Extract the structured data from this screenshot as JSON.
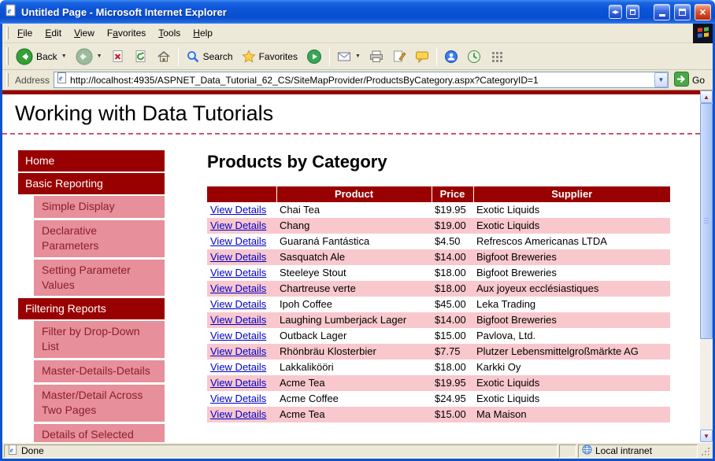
{
  "window": {
    "title": "Untitled Page - Microsoft Internet Explorer",
    "status": {
      "left": "Done",
      "zone": "Local intranet"
    }
  },
  "menu": {
    "items": [
      {
        "label": "File",
        "accel": 0
      },
      {
        "label": "Edit",
        "accel": 0
      },
      {
        "label": "View",
        "accel": 0
      },
      {
        "label": "Favorites",
        "accel": 1
      },
      {
        "label": "Tools",
        "accel": 0
      },
      {
        "label": "Help",
        "accel": 0
      }
    ]
  },
  "toolbar": {
    "back_label": "Back",
    "search_label": "Search",
    "favorites_label": "Favorites"
  },
  "address": {
    "label": "Address",
    "url": "http://localhost:4935/ASPNET_Data_Tutorial_62_CS/SiteMapProvider/ProductsByCategory.aspx?CategoryID=1",
    "go_label": "Go"
  },
  "page": {
    "site_title": "Working with Data Tutorials",
    "heading": "Products by Category",
    "nav": [
      {
        "label": "Home",
        "level": 1
      },
      {
        "label": "Basic Reporting",
        "level": 1
      },
      {
        "label": "Simple Display",
        "level": 2
      },
      {
        "label": "Declarative Parameters",
        "level": 2
      },
      {
        "label": "Setting Parameter Values",
        "level": 2
      },
      {
        "label": "Filtering Reports",
        "level": 1
      },
      {
        "label": "Filter by Drop-Down List",
        "level": 2
      },
      {
        "label": "Master-Details-Details",
        "level": 2
      },
      {
        "label": "Master/Detail Across Two Pages",
        "level": 2
      },
      {
        "label": "Details of Selected Row",
        "level": 2
      }
    ],
    "table": {
      "columns": [
        "",
        "Product",
        "Price",
        "Supplier"
      ],
      "link_label": "View Details",
      "rows": [
        {
          "product": "Chai Tea",
          "price": "$19.95",
          "supplier": "Exotic Liquids"
        },
        {
          "product": "Chang",
          "price": "$19.00",
          "supplier": "Exotic Liquids"
        },
        {
          "product": "Guaraná Fantástica",
          "price": "$4.50",
          "supplier": "Refrescos Americanas LTDA"
        },
        {
          "product": "Sasquatch Ale",
          "price": "$14.00",
          "supplier": "Bigfoot Breweries"
        },
        {
          "product": "Steeleye Stout",
          "price": "$18.00",
          "supplier": "Bigfoot Breweries"
        },
        {
          "product": "Chartreuse verte",
          "price": "$18.00",
          "supplier": "Aux joyeux ecclésiastiques"
        },
        {
          "product": "Ipoh Coffee",
          "price": "$45.00",
          "supplier": "Leka Trading"
        },
        {
          "product": "Laughing Lumberjack Lager",
          "price": "$14.00",
          "supplier": "Bigfoot Breweries"
        },
        {
          "product": "Outback Lager",
          "price": "$15.00",
          "supplier": "Pavlova, Ltd."
        },
        {
          "product": "Rhönbräu Klosterbier",
          "price": "$7.75",
          "supplier": "Plutzer Lebensmittelgroßmärkte AG"
        },
        {
          "product": "Lakkalikööri",
          "price": "$18.00",
          "supplier": "Karkki Oy"
        },
        {
          "product": "Acme Tea",
          "price": "$19.95",
          "supplier": "Exotic Liquids"
        },
        {
          "product": "Acme Coffee",
          "price": "$24.95",
          "supplier": "Exotic Liquids"
        },
        {
          "product": "Acme Tea",
          "price": "$15.00",
          "supplier": "Ma Maison"
        }
      ]
    }
  },
  "colors": {
    "maroon": "#990000",
    "nav_sub_bg": "#e78f9a",
    "row_alt_bg": "#f8c8cd",
    "link_blue": "#0000cc",
    "chrome_tan": "#ece9d8",
    "title_blue": "#0b54d6"
  }
}
